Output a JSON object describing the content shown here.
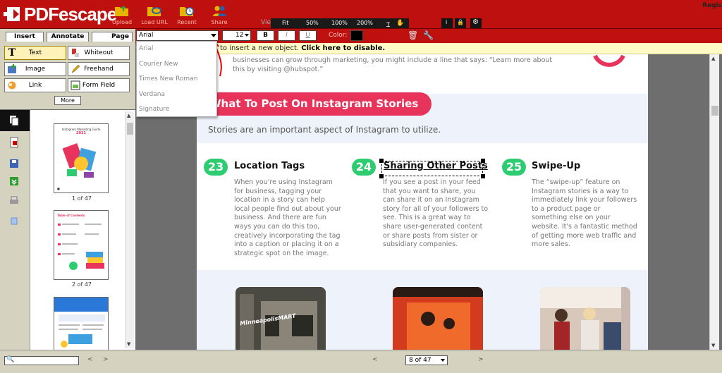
{
  "app": {
    "logo_text": "PDFescape",
    "top_right": "Regis"
  },
  "toolbar": {
    "buttons": [
      {
        "label": "Upload",
        "icon": "upload-folder-icon"
      },
      {
        "label": "Load URL",
        "icon": "load-url-icon"
      },
      {
        "label": "Recent",
        "icon": "recent-clock-icon"
      },
      {
        "label": "Share",
        "icon": "share-people-icon"
      }
    ],
    "view_label": "View:",
    "zoom": [
      "Fit",
      "50%",
      "100%",
      "200%"
    ]
  },
  "tabs": [
    "Insert",
    "Annotate",
    "Page"
  ],
  "tools": {
    "text": "Text",
    "whiteout": "Whiteout",
    "image": "Image",
    "freehand": "Freehand",
    "link": "Link",
    "form_field": "Form Field",
    "more": "More"
  },
  "format": {
    "font": "Arial",
    "size": "12",
    "bold": "B",
    "italic": "I",
    "underline": "U",
    "color_label": "Color:",
    "color_value": "#000000"
  },
  "font_options": [
    "Arial",
    "Courier New",
    "Times New Roman",
    "Verdana",
    "Signature"
  ],
  "notice": {
    "text": "to insert a new object. ",
    "link": "Click here to disable."
  },
  "thumbnails": [
    {
      "label": "1 of 47",
      "title_line1": "Instagram Marketing Guide",
      "title_line2": "2021"
    },
    {
      "label": "2 of 47",
      "title_line1": "Table of Contents"
    }
  ],
  "pagination": {
    "current": "8 of 47"
  },
  "page": {
    "intro_text": "businesses can grow through marketing, you might include a line that says: “Learn more about this by visiting @hubspot.”",
    "section_title": "What To Post On Instagram Stories",
    "section_sub": "Stories are an important aspect of Instagram to utilize.",
    "columns": [
      {
        "num": "23",
        "title": "Location Tags",
        "body": "When you're using Instagram for business, tagging your location in a story can help local people find out about your business. And there are fun ways you can do this too, creatively incorporating the tag into a caption or placing it on a strategic spot on the image."
      },
      {
        "num": "24",
        "title": "Sharing Other Posts",
        "body": "If you see a post in your feed that you want to share, you can share it on an Instagram story for all of your followers to see. This is a great way to share user-generated content or share posts from sister or subsidiary companies."
      },
      {
        "num": "25",
        "title": "Swipe-Up",
        "body": "The “swipe-up” feature on Instagram stories is a way to immediately link your followers to a product page or something else on your website. It's a fantastic method of getting more web traffic and more sales."
      }
    ],
    "photo_labels": [
      "MinneapolisMART",
      "",
      ""
    ]
  },
  "colors": {
    "brand": "#bf1010",
    "green": "#2ecc71",
    "pink": "#e8335a"
  }
}
